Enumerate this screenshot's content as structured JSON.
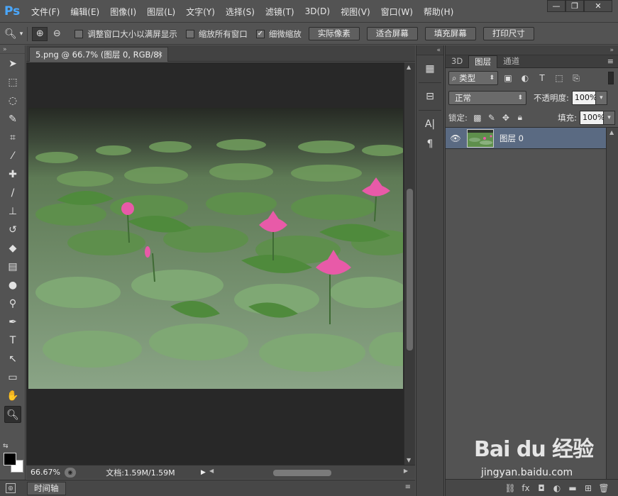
{
  "app": {
    "logo": "Ps"
  },
  "menu": [
    "文件(F)",
    "编辑(E)",
    "图像(I)",
    "图层(L)",
    "文字(Y)",
    "选择(S)",
    "滤镜(T)",
    "3D(D)",
    "视图(V)",
    "窗口(W)",
    "帮助(H)"
  ],
  "window_controls": {
    "minimize": "—",
    "maximize": "❐",
    "close": "✕"
  },
  "options_bar": {
    "checkbox_resize": {
      "label": "调整窗口大小以满屏显示",
      "checked": false
    },
    "checkbox_zoom_all": {
      "label": "缩放所有窗口",
      "checked": false
    },
    "checkbox_scrubby": {
      "label": "细微缩放",
      "checked": true
    },
    "btn_actual": "实际像素",
    "btn_fit": "适合屏幕",
    "btn_fill": "填充屏幕",
    "btn_print": "打印尺寸"
  },
  "document": {
    "tab_title": "5.png @ 66.7% (图层 0, RGB/8)",
    "tab_close": "×"
  },
  "status": {
    "zoom": "66.67%",
    "doc_size": "文档:1.59M/1.59M"
  },
  "timeline": {
    "label": "时间轴"
  },
  "layers_panel": {
    "tabs": [
      "3D",
      "图层",
      "通道"
    ],
    "active_tab": "图层",
    "filter_kind": "类型",
    "blend_mode": "正常",
    "opacity_label": "不透明度:",
    "opacity_value": "100%",
    "lock_label": "锁定:",
    "fill_label": "填充:",
    "fill_value": "100%",
    "layers": [
      {
        "name": "图层 0",
        "visible": true
      }
    ]
  },
  "watermark": {
    "logo": "Bai du 经验",
    "url": "jingyan.baidu.com"
  },
  "colors": {
    "foreground": "#000000",
    "background": "#ffffff",
    "selected_layer": "#5a6a82"
  }
}
